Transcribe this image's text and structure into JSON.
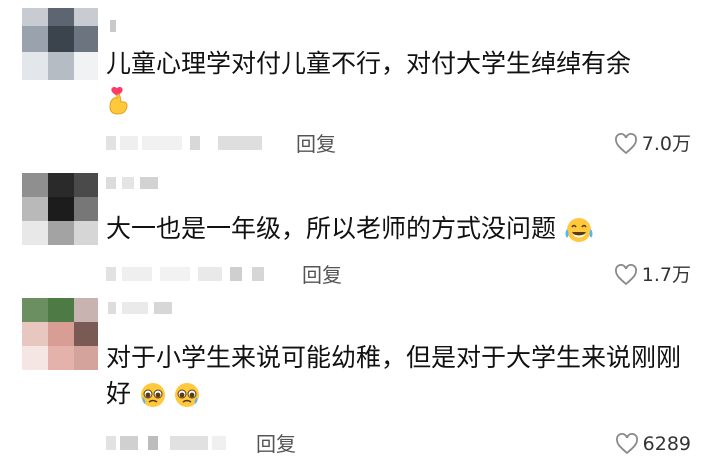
{
  "comments": [
    {
      "text": "儿童心理学对付儿童不行，对付大学生绰绰有余",
      "emoji": "hand-heart-emoji",
      "reply_label": "回复",
      "likes": "7.0万"
    },
    {
      "text": "大一也是一年级，所以老师的方式没问题",
      "emoji": "tears-of-joy-emoji",
      "reply_label": "回复",
      "likes": "1.7万"
    },
    {
      "text": "对于小学生来说可能幼稚，但是对于大学生来说刚刚好",
      "emoji": "pleading-face-emoji",
      "reply_label": "回复",
      "likes": "6289"
    }
  ],
  "icons": {
    "like": "heart-outline-icon"
  },
  "colors": {
    "text": "#111111",
    "meta": "#555555",
    "heart": "#8a8a8a"
  }
}
